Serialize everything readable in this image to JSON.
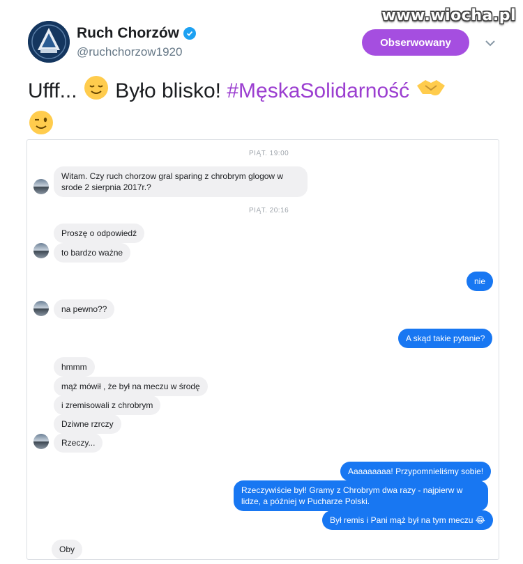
{
  "watermark": "www.wiocha.pl",
  "profile": {
    "name": "Ruch Chorzów",
    "handle": "@ruchchorzow1920",
    "follow_label": "Obserwowany",
    "verified_icon": "verified-badge-icon",
    "avatar_icon": "ruch-chorzow-crest-logo",
    "more_icon": "chevron-down-icon"
  },
  "tweet": {
    "text_a": "Ufff...",
    "text_b": "Było blisko!",
    "hashtag": "#MęskaSolidarność",
    "emojis": [
      "relieved-face-emoji",
      "handshake-emoji",
      "winking-face-emoji"
    ]
  },
  "chat": {
    "ts1": "PIĄT. 19:00",
    "ts2": "PIĄT. 20:16",
    "messages": [
      {
        "from": "them",
        "text": "Witam. Czy ruch chorzow gral sparing z chrobrym glogow w srode 2 sierpnia 2017r.?"
      },
      {
        "from": "them",
        "text": "Proszę o odpowiedź"
      },
      {
        "from": "them",
        "text": "to bardzo ważne"
      },
      {
        "from": "me",
        "text": "nie"
      },
      {
        "from": "them",
        "text": "na pewno??"
      },
      {
        "from": "me",
        "text": "A skąd takie pytanie?"
      },
      {
        "from": "them",
        "text": "hmmm"
      },
      {
        "from": "them",
        "text": "mąż mówił , że był na meczu w środę"
      },
      {
        "from": "them",
        "text": "i zremisowali z chrobrym"
      },
      {
        "from": "them",
        "text": "Dziwne rzrczy"
      },
      {
        "from": "them",
        "text": "Rzeczy..."
      },
      {
        "from": "me",
        "text": "Aaaaaaaaa! Przypomnieliśmy sobie!"
      },
      {
        "from": "me",
        "text": "Rzeczywiście był! Gramy z Chrobrym dwa razy - najpierw w lidze, a później w Pucharze Polski."
      },
      {
        "from": "me",
        "text": "Był remis i Pani mąż był na tym meczu 😂"
      },
      {
        "from": "them",
        "text": "Oby"
      }
    ],
    "colors": {
      "incoming": "#f0f0f2",
      "outgoing": "#1877f2",
      "follow": "#a54ee0",
      "hashtag": "#9b3ed0"
    }
  }
}
